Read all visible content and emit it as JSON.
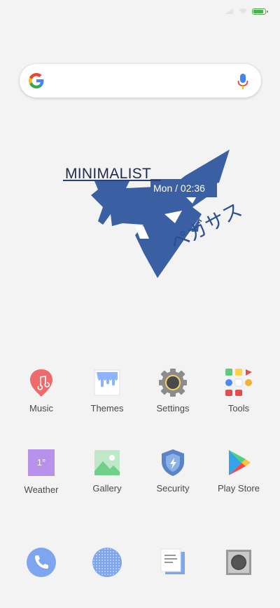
{
  "widget": {
    "title": "MINIMALIST",
    "clock": "Mon / 02:36",
    "jp_text": "ペガサス"
  },
  "apps_row1": [
    {
      "label": "Music",
      "icon": "music-icon"
    },
    {
      "label": "Themes",
      "icon": "themes-icon"
    },
    {
      "label": "Settings",
      "icon": "settings-icon"
    },
    {
      "label": "Tools",
      "icon": "tools-folder-icon"
    }
  ],
  "apps_row2": [
    {
      "label": "Weather",
      "icon": "weather-icon",
      "badge": "1°"
    },
    {
      "label": "Gallery",
      "icon": "gallery-icon"
    },
    {
      "label": "Security",
      "icon": "security-icon"
    },
    {
      "label": "Play Store",
      "icon": "play-store-icon"
    }
  ],
  "dock": [
    {
      "icon": "phone-icon"
    },
    {
      "icon": "browser-icon"
    },
    {
      "icon": "messages-icon"
    },
    {
      "icon": "camera-icon"
    }
  ],
  "colors": {
    "accent_blue": "#3a5fa3",
    "battery_green": "#4caf50"
  }
}
